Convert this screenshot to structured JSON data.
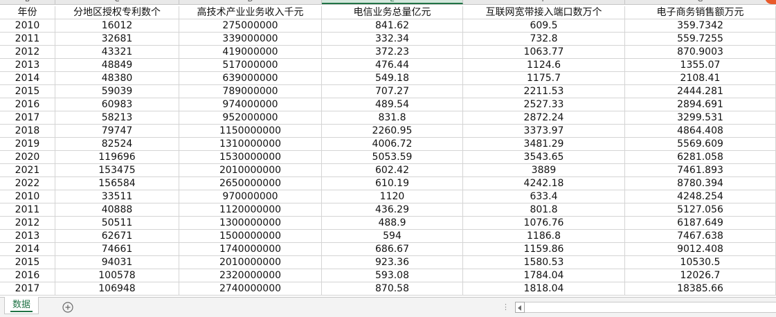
{
  "sheet": {
    "column_letters": [
      "B",
      "C",
      "D",
      "E",
      "F",
      "G"
    ],
    "headers": [
      "年份",
      "分地区授权专利数个",
      "高技术产业业务收入千元",
      "电信业务总量亿元",
      "互联网宽带接入端口数万个",
      "电子商务销售额万元"
    ],
    "rows": [
      [
        "2010",
        "16012",
        "275000000",
        "841.62",
        "609.5",
        "359.7342"
      ],
      [
        "2011",
        "32681",
        "339000000",
        "332.34",
        "732.8",
        "559.7255"
      ],
      [
        "2012",
        "43321",
        "419000000",
        "372.23",
        "1063.77",
        "870.9003"
      ],
      [
        "2013",
        "48849",
        "517000000",
        "476.44",
        "1124.6",
        "1355.07"
      ],
      [
        "2014",
        "48380",
        "639000000",
        "549.18",
        "1175.7",
        "2108.41"
      ],
      [
        "2015",
        "59039",
        "789000000",
        "707.27",
        "2211.53",
        "2444.281"
      ],
      [
        "2016",
        "60983",
        "974000000",
        "489.54",
        "2527.33",
        "2894.691"
      ],
      [
        "2017",
        "58213",
        "952000000",
        "831.8",
        "2872.24",
        "3299.531"
      ],
      [
        "2018",
        "79747",
        "1150000000",
        "2260.95",
        "3373.97",
        "4864.408"
      ],
      [
        "2019",
        "82524",
        "1310000000",
        "4006.72",
        "3481.29",
        "5569.609"
      ],
      [
        "2020",
        "119696",
        "1530000000",
        "5053.59",
        "3543.65",
        "6281.058"
      ],
      [
        "2021",
        "153475",
        "2010000000",
        "602.42",
        "3889",
        "7461.893"
      ],
      [
        "2022",
        "156584",
        "2650000000",
        "610.19",
        "4242.18",
        "8780.394"
      ],
      [
        "2010",
        "33511",
        "970000000",
        "1120",
        "633.4",
        "4248.254"
      ],
      [
        "2011",
        "40888",
        "1120000000",
        "436.29",
        "801.8",
        "5127.056"
      ],
      [
        "2012",
        "50511",
        "1300000000",
        "488.9",
        "1076.76",
        "6187.649"
      ],
      [
        "2013",
        "62671",
        "1500000000",
        "594",
        "1186.8",
        "7467.638"
      ],
      [
        "2014",
        "74661",
        "1740000000",
        "686.67",
        "1159.86",
        "9012.408"
      ],
      [
        "2015",
        "94031",
        "2010000000",
        "923.36",
        "1580.53",
        "10530.5"
      ],
      [
        "2016",
        "100578",
        "2320000000",
        "593.08",
        "1784.04",
        "12026.7"
      ],
      [
        "2017",
        "106948",
        "2740000000",
        "870.58",
        "1818.04",
        "18385.66"
      ]
    ]
  },
  "sheet_tabs": [
    {
      "label": "数据",
      "active": true
    }
  ],
  "icons": {
    "add_sheet": "plus-circle-icon",
    "scroll_left": "chevron-left-icon"
  },
  "colors": {
    "accent": "#217346",
    "gridline": "#d4d4d4",
    "header_bg": "#e9e9e9"
  }
}
